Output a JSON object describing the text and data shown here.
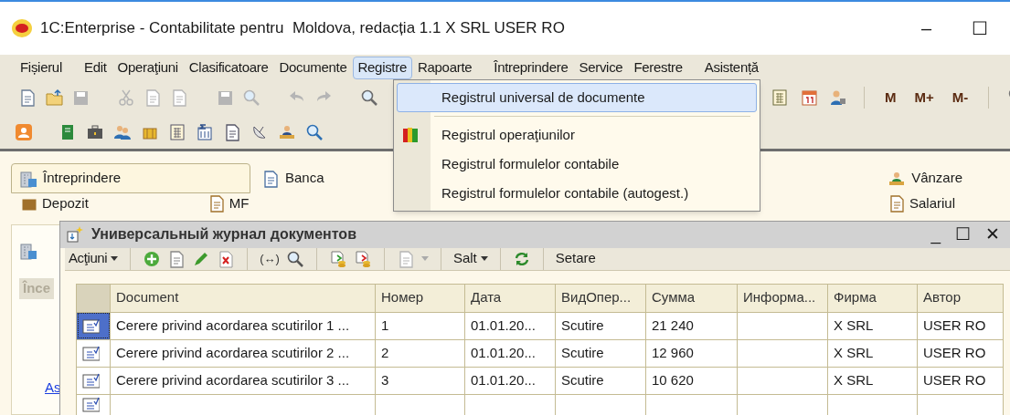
{
  "window": {
    "title": "1C:Enterprise - Contabilitate pentru  Moldova, redacția 1.1 X SRL USER RO",
    "controls": [
      "–",
      "☐"
    ]
  },
  "menu": [
    {
      "label": "Fișierul",
      "selected": false
    },
    {
      "label": "Edit",
      "selected": false
    },
    {
      "label": "Operaţiuni",
      "selected": false
    },
    {
      "label": "Clasificatoare",
      "selected": false
    },
    {
      "label": "Documente",
      "selected": false
    },
    {
      "label": "Registre",
      "selected": true
    },
    {
      "label": "Rapoarte",
      "selected": false
    },
    {
      "label": "Întreprindere",
      "selected": false
    },
    {
      "label": "Service",
      "selected": false
    },
    {
      "label": "Ferestre",
      "selected": false
    },
    {
      "label": "Asistență",
      "selected": false
    }
  ],
  "toolbar_labels": [
    "M",
    "M+",
    "M-"
  ],
  "dropdown": [
    {
      "label": "Registrul universal de documente",
      "highlighted": true,
      "icon": false
    },
    {
      "label": "Registrul operaţiunilor",
      "highlighted": false,
      "icon": true
    },
    {
      "label": "Registrul formulelor contabile",
      "highlighted": false,
      "icon": false
    },
    {
      "label": "Registrul formulelor contabile (autogest.)",
      "highlighted": false,
      "icon": false
    }
  ],
  "panel_tabs": [
    {
      "label": "Întreprindere",
      "selected": true
    },
    {
      "label": "Banca",
      "selected": false
    },
    {
      "label": "Vânzare",
      "selected": false
    }
  ],
  "panel_sections": [
    "Depozit",
    "MF",
    "Salariul"
  ],
  "side": {
    "heading": "Înce",
    "link": "As"
  },
  "journal": {
    "title": "Универсальный журнал документов",
    "controls": [
      "_",
      "☐",
      "✕"
    ],
    "toolbar": {
      "actions": "Acţiuni",
      "jump": "Salt",
      "settings": "Setare",
      "bracket": "(↔)"
    },
    "columns": [
      "Document",
      "Номер",
      "Дата",
      "ВидОпер...",
      "Сумма",
      "Информа...",
      "Фирма",
      "Автор"
    ],
    "rows": [
      {
        "selected": true,
        "cells": [
          "Cerere privind acordarea scutirilor 1 ...",
          "1",
          "01.01.20...",
          "Scutire",
          "21 240",
          "",
          "X SRL",
          "USER RO"
        ]
      },
      {
        "selected": false,
        "cells": [
          "Cerere privind acordarea scutirilor 2 ...",
          "2",
          "01.01.20...",
          "Scutire",
          "12 960",
          "",
          "X SRL",
          "USER RO"
        ]
      },
      {
        "selected": false,
        "cells": [
          "Cerere privind acordarea scutirilor 3 ...",
          "3",
          "01.01.20...",
          "Scutire",
          "10 620",
          "",
          "X SRL",
          "USER RO"
        ]
      }
    ]
  }
}
